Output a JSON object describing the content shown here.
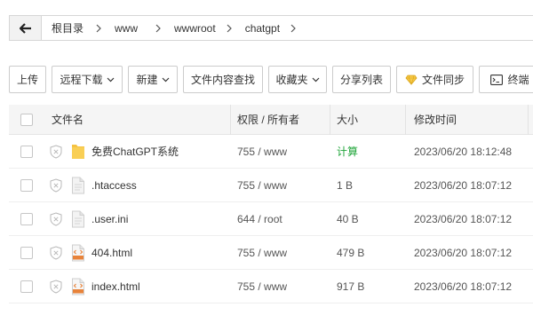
{
  "breadcrumb": {
    "items": [
      "根目录",
      "www",
      "wwwroot",
      "chatgpt"
    ]
  },
  "toolbar": {
    "upload": "上传",
    "remote_download": "远程下载",
    "new": "新建",
    "content_search": "文件内容查找",
    "favorites": "收藏夹",
    "share_list": "分享列表",
    "file_sync": "文件同步",
    "terminal": "终端"
  },
  "table": {
    "headers": {
      "name": "文件名",
      "perm": "权限 / 所有者",
      "size": "大小",
      "mtime": "修改时间"
    },
    "rows": [
      {
        "name": "免费ChatGPT系统",
        "type": "folder",
        "perm": "755 / www",
        "size": "计算",
        "mtime": "2023/06/20 18:12:48"
      },
      {
        "name": ".htaccess",
        "type": "file",
        "perm": "755 / www",
        "size": "1 B",
        "mtime": "2023/06/20 18:07:12"
      },
      {
        "name": ".user.ini",
        "type": "file",
        "perm": "644 / root",
        "size": "40 B",
        "mtime": "2023/06/20 18:07:12"
      },
      {
        "name": "404.html",
        "type": "html",
        "perm": "755 / www",
        "size": "479 B",
        "mtime": "2023/06/20 18:07:12"
      },
      {
        "name": "index.html",
        "type": "html",
        "perm": "755 / www",
        "size": "917 B",
        "mtime": "2023/06/20 18:07:12"
      }
    ]
  },
  "colors": {
    "accent_green": "#20a53a",
    "folder_yellow": "#f5c242",
    "html_orange": "#e8833a"
  }
}
